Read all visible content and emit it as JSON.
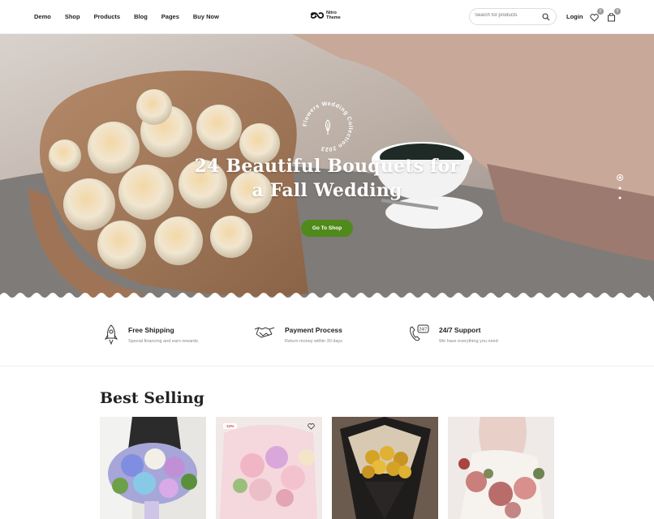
{
  "nav": {
    "items": [
      "Demo",
      "Shop",
      "Products",
      "Blog",
      "Pages",
      "Buy Now"
    ]
  },
  "logo": {
    "line1": "Nitro",
    "line2": "Theme"
  },
  "search": {
    "placeholder": "Search for products"
  },
  "header": {
    "login": "Login",
    "wishlist_count": "0",
    "cart_count": "0"
  },
  "hero": {
    "badge_text": "Flowers Wedding Collection 2023",
    "title_line1": "24 Beautiful Bouquets for",
    "title_line2": "a Fall Wedding",
    "button": "Go To Shop"
  },
  "features": [
    {
      "title": "Free Shipping",
      "subtitle": "Special financing and earn rewards.",
      "icon": "rocket-icon"
    },
    {
      "title": "Payment Process",
      "subtitle": "Return money within 30 days",
      "icon": "handshake-icon"
    },
    {
      "title": "24/7 Support",
      "subtitle": "We have everything you need",
      "icon": "support-phone-icon"
    }
  ],
  "best_selling": {
    "heading": "Best Selling",
    "sale_badge": "-12%"
  },
  "colors": {
    "accent": "#4f8a1b"
  }
}
